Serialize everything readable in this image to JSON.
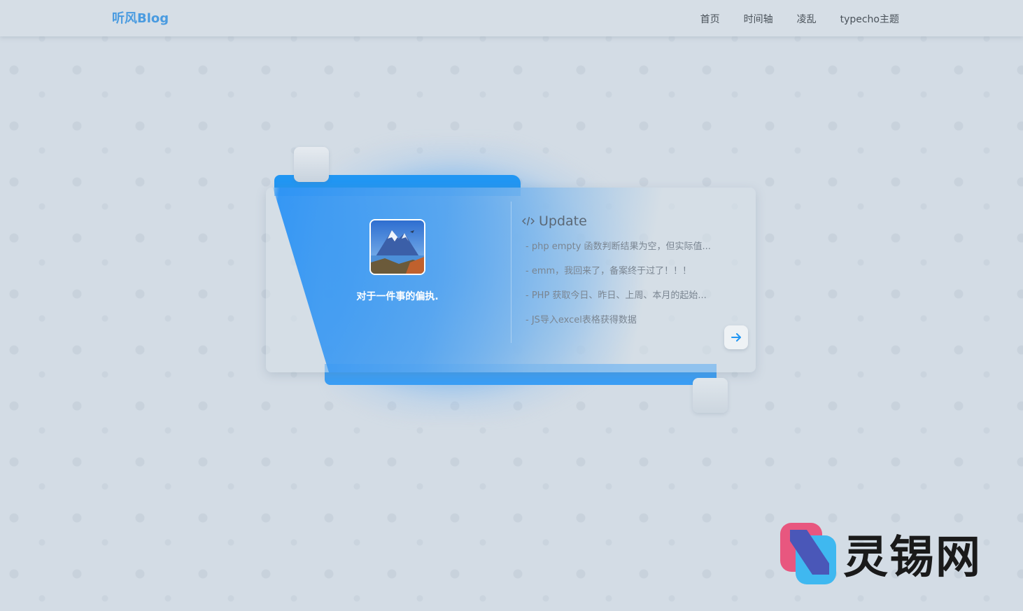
{
  "nav": {
    "brand": "听风Blog",
    "links": [
      "首页",
      "时间轴",
      "凌乱",
      "typecho主题"
    ]
  },
  "profile": {
    "motto": "对于一件事的偏执."
  },
  "updates": {
    "title": "Update",
    "icon": "code-icon",
    "posts": [
      "- php empty 函数判断结果为空，但实际值...",
      "- emm，我回来了，备案终于过了！！！",
      "- PHP 获取今日、昨日、上周、本月的起始...",
      "- JS导入excel表格获得数据"
    ],
    "more_icon": "arrow-right-icon"
  },
  "watermark": {
    "text": "灵锡网"
  },
  "colors": {
    "accent": "#2196f3",
    "brand": "#4a9be0",
    "background": "#d3dce5"
  }
}
